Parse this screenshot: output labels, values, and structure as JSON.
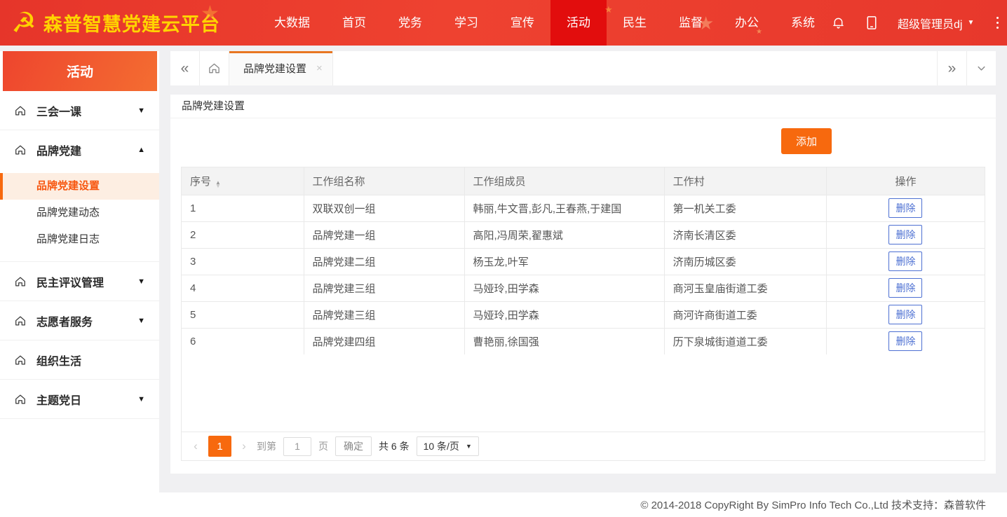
{
  "navbar": {
    "logo": {
      "emblem_icon": "party-emblem",
      "title": "森普智慧党建云平台"
    },
    "items": [
      {
        "label": "大数据",
        "active": false
      },
      {
        "label": "首页",
        "active": false
      },
      {
        "label": "党务",
        "active": false
      },
      {
        "label": "学习",
        "active": false
      },
      {
        "label": "宣传",
        "active": false
      },
      {
        "label": "活动",
        "active": true
      },
      {
        "label": "民生",
        "active": false
      },
      {
        "label": "监督",
        "active": false
      },
      {
        "label": "办公",
        "active": false
      },
      {
        "label": "系统",
        "active": false
      }
    ],
    "bell_icon": "bell",
    "phone_icon": "mobile-phone",
    "user": {
      "name": "超级管理员dj",
      "caret": "▼"
    },
    "more_icon": "vertical-ellipsis"
  },
  "sidebar": {
    "title": "活动",
    "groups": [
      {
        "label": "三会一课",
        "icon": "home",
        "caret": "down"
      },
      {
        "label": "品牌党建",
        "icon": "home",
        "caret": "up",
        "expanded": true,
        "children": [
          {
            "label": "品牌党建设置",
            "active": true
          },
          {
            "label": "品牌党建动态",
            "active": false
          },
          {
            "label": "品牌党建日志",
            "active": false
          }
        ]
      },
      {
        "label": "民主评议管理",
        "icon": "home",
        "caret": "down"
      },
      {
        "label": "志愿者服务",
        "icon": "home",
        "caret": "down"
      },
      {
        "label": "组织生活",
        "icon": "home",
        "caret": null
      },
      {
        "label": "主题党日",
        "icon": "home",
        "caret": "down"
      }
    ]
  },
  "tabbar": {
    "collapse_label": "«",
    "expand_label": "»",
    "home_icon": "home",
    "chevron_down_icon": "chevron-down",
    "tabs": [
      {
        "label": "品牌党建设置",
        "close": "×",
        "active": true
      }
    ]
  },
  "page": {
    "title": "品牌党建设置",
    "add_button": "添加"
  },
  "table": {
    "headers": [
      "序号",
      "工作组名称",
      "工作组成员",
      "工作村",
      "操作"
    ],
    "sortable_column": "序号",
    "rows": [
      {
        "no": "1",
        "group": "双联双创一组",
        "members": "韩丽,牛文晋,彭凡,王春燕,于建国",
        "village": "第一机关工委",
        "action": "删除"
      },
      {
        "no": "2",
        "group": "品牌党建一组",
        "members": "高阳,冯周荣,翟惠斌",
        "village": "济南长清区委",
        "action": "删除"
      },
      {
        "no": "3",
        "group": "品牌党建二组",
        "members": "杨玉龙,叶军",
        "village": "济南历城区委",
        "action": "删除"
      },
      {
        "no": "4",
        "group": "品牌党建三组",
        "members": "马娅玲,田学森",
        "village": "商河玉皇庙街道工委",
        "action": "删除"
      },
      {
        "no": "5",
        "group": "品牌党建三组",
        "members": "马娅玲,田学森",
        "village": "商河许商街道工委",
        "action": "删除"
      },
      {
        "no": "6",
        "group": "品牌党建四组",
        "members": "曹艳丽,徐国强",
        "village": "历下泉城街道道工委",
        "action": "删除"
      }
    ]
  },
  "pagination": {
    "prev": "‹",
    "current_page": "1",
    "next": "›",
    "goto_prefix": "到第",
    "goto_value": "1",
    "goto_suffix": "页",
    "confirm_button": "确定",
    "total_label": "共 6 条",
    "page_size_label": "10 条/页"
  },
  "footer": {
    "copyright": "© 2014-2018 CopyRight By SimPro Info Tech Co.,Ltd 技术支持：森普软件"
  },
  "colors": {
    "navbar_red": "#e93a2e",
    "navbar_active_red": "#e20d0d",
    "logo_gold": "#ffd100",
    "sidebar_header_gradient": [
      "#ee452e",
      "#f46d31"
    ],
    "accent_orange": "#f7690e",
    "active_menu_bg": "#fdeee2",
    "delete_blue": "#4d70d2",
    "page_bg": "#f0f0f2",
    "table_header_bg": "#f3f3f3",
    "table_border": "#e9e9e9"
  }
}
